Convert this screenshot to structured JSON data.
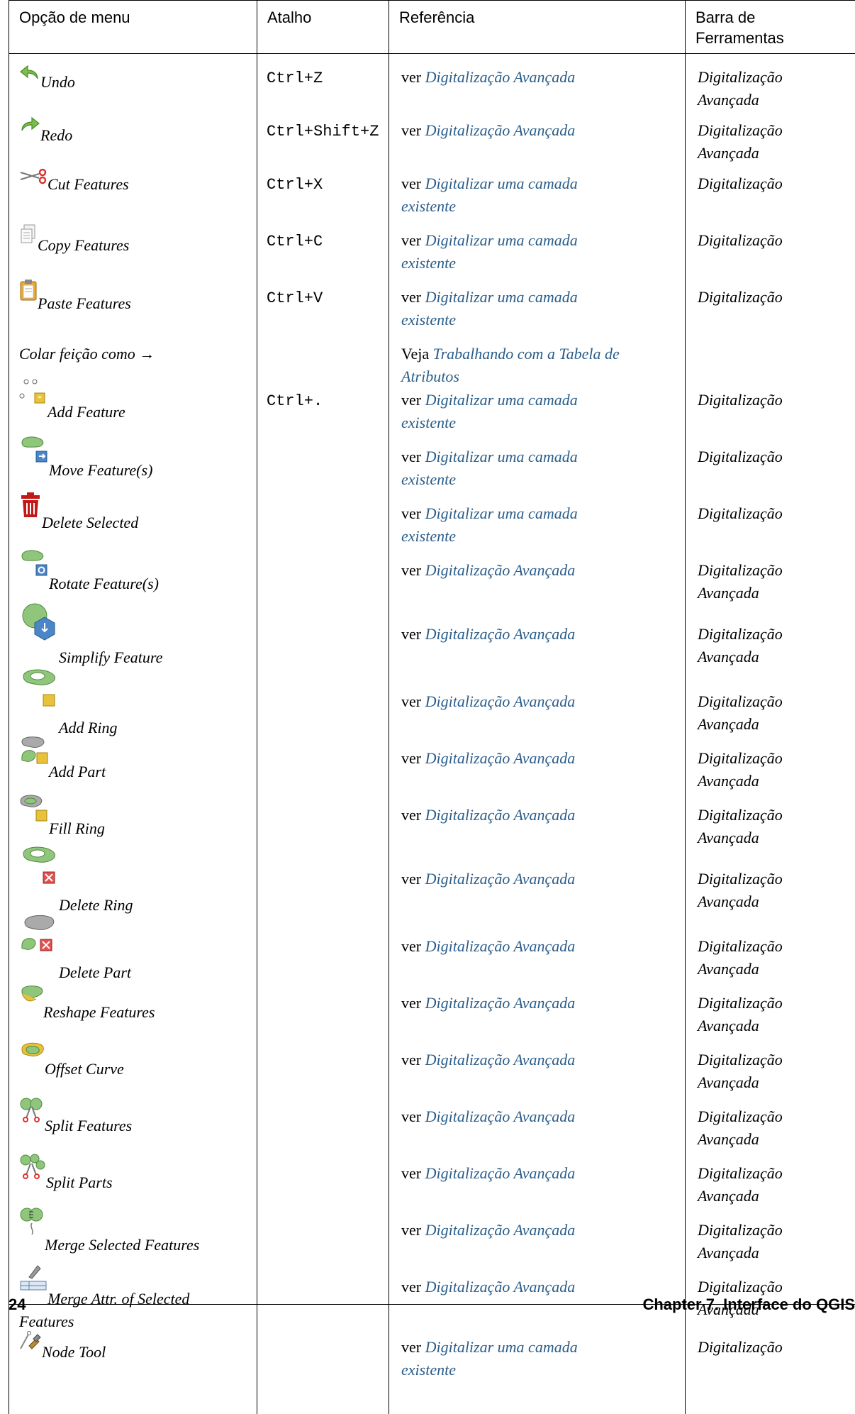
{
  "header": {
    "col1": "Opção de menu",
    "col2": "Atalho",
    "col3": "Referência",
    "col4_line1": "Barra de",
    "col4_line2": "Ferramentas"
  },
  "rows": [
    {
      "name": "Undo",
      "icon": "undo-icon",
      "shortcut": "Ctrl+Z",
      "ref_prefix": "ver",
      "ref_l1": "Digitalização Avançada",
      "ref_l2": "",
      "tb1": "Digitalização",
      "tb2": "Avançada"
    },
    {
      "name": "Redo",
      "icon": "redo-icon",
      "shortcut": "Ctrl+Shift+Z",
      "ref_prefix": "ver",
      "ref_l1": "Digitalização Avançada",
      "ref_l2": "",
      "tb1": "Digitalização",
      "tb2": "Avançada"
    },
    {
      "name": "Cut Features",
      "icon": "scissors-icon",
      "shortcut": "Ctrl+X",
      "ref_prefix": "ver",
      "ref_l1": "Digitalizar uma camada",
      "ref_l2": "existente",
      "tb1": "Digitalização",
      "tb2": ""
    },
    {
      "name": "Copy Features",
      "icon": "copy-icon",
      "shortcut": "Ctrl+C",
      "ref_prefix": "ver",
      "ref_l1": "Digitalizar uma camada",
      "ref_l2": "existente",
      "tb1": "Digitalização",
      "tb2": ""
    },
    {
      "name": "Paste Features",
      "icon": "clipboard-icon",
      "shortcut": "Ctrl+V",
      "ref_prefix": "ver",
      "ref_l1": "Digitalizar uma camada",
      "ref_l2": "existente",
      "tb1": "Digitalização",
      "tb2": ""
    },
    {
      "name": "Colar feição como →",
      "icon": "",
      "shortcut": "",
      "ref_prefix": "Veja",
      "ref_l1": "Trabalhando com a Tabela de",
      "ref_l2": "Atributos",
      "tb1": "",
      "tb2": ""
    },
    {
      "name": "Add Feature",
      "icon": "add-feature-icon",
      "shortcut": "Ctrl+.",
      "ref_prefix": "ver",
      "ref_l1": "Digitalizar uma camada",
      "ref_l2": "existente",
      "tb1": "Digitalização",
      "tb2": ""
    },
    {
      "name": "Move Feature(s)",
      "icon": "move-feature-icon",
      "shortcut": "",
      "ref_prefix": "ver",
      "ref_l1": "Digitalizar uma camada",
      "ref_l2": "existente",
      "tb1": "Digitalização",
      "tb2": ""
    },
    {
      "name": "Delete Selected",
      "icon": "trash-icon",
      "shortcut": "",
      "ref_prefix": "ver",
      "ref_l1": "Digitalizar uma camada",
      "ref_l2": "existente",
      "tb1": "Digitalização",
      "tb2": ""
    },
    {
      "name": "Rotate Feature(s)",
      "icon": "rotate-feature-icon",
      "shortcut": "",
      "ref_prefix": "ver",
      "ref_l1": "Digitalização Avançada",
      "ref_l2": "",
      "tb1": "Digitalização",
      "tb2": "Avançada"
    },
    {
      "name": "Simplify Feature",
      "icon": "simplify-feature-icon",
      "shortcut": "",
      "ref_prefix": "ver",
      "ref_l1": "Digitalização Avançada",
      "ref_l2": "",
      "tb1": "Digitalização",
      "tb2": "Avançada"
    },
    {
      "name": "Add Ring",
      "icon": "add-ring-icon",
      "shortcut": "",
      "ref_prefix": "ver",
      "ref_l1": "Digitalização Avançada",
      "ref_l2": "",
      "tb1": "Digitalização",
      "tb2": "Avançada"
    },
    {
      "name": "Add Part",
      "icon": "add-part-icon",
      "shortcut": "",
      "ref_prefix": "ver",
      "ref_l1": "Digitalização Avançada",
      "ref_l2": "",
      "tb1": "Digitalização",
      "tb2": "Avançada"
    },
    {
      "name": "Fill Ring",
      "icon": "fill-ring-icon",
      "shortcut": "",
      "ref_prefix": "ver",
      "ref_l1": "Digitalização Avançada",
      "ref_l2": "",
      "tb1": "Digitalização",
      "tb2": "Avançada"
    },
    {
      "name": "Delete Ring",
      "icon": "delete-ring-icon",
      "shortcut": "",
      "ref_prefix": "ver",
      "ref_l1": "Digitalização Avançada",
      "ref_l2": "",
      "tb1": "Digitalização",
      "tb2": "Avançada"
    },
    {
      "name": "Delete Part",
      "icon": "delete-part-icon",
      "shortcut": "",
      "ref_prefix": "ver",
      "ref_l1": "Digitalização Avançada",
      "ref_l2": "",
      "tb1": "Digitalização",
      "tb2": "Avançada"
    },
    {
      "name": "Reshape Features",
      "icon": "reshape-features-icon",
      "shortcut": "",
      "ref_prefix": "ver",
      "ref_l1": "Digitalização Avançada",
      "ref_l2": "",
      "tb1": "Digitalização",
      "tb2": "Avançada"
    },
    {
      "name": "Offset Curve",
      "icon": "offset-curve-icon",
      "shortcut": "",
      "ref_prefix": "ver",
      "ref_l1": "Digitalização Avançada",
      "ref_l2": "",
      "tb1": "Digitalização",
      "tb2": "Avançada"
    },
    {
      "name": "Split Features",
      "icon": "split-features-icon",
      "shortcut": "",
      "ref_prefix": "ver",
      "ref_l1": "Digitalização Avançada",
      "ref_l2": "",
      "tb1": "Digitalização",
      "tb2": "Avançada"
    },
    {
      "name": "Split Parts",
      "icon": "split-parts-icon",
      "shortcut": "",
      "ref_prefix": "ver",
      "ref_l1": "Digitalização Avançada",
      "ref_l2": "",
      "tb1": "Digitalização",
      "tb2": "Avançada"
    },
    {
      "name": "Merge Selected Features",
      "icon": "merge-features-icon",
      "shortcut": "",
      "ref_prefix": "ver",
      "ref_l1": "Digitalização Avançada",
      "ref_l2": "",
      "tb1": "Digitalização",
      "tb2": "Avançada"
    },
    {
      "name": "Merge Attr. of Selected",
      "name2": "Features",
      "icon": "merge-attributes-icon",
      "shortcut": "",
      "ref_prefix": "ver",
      "ref_l1": "Digitalização Avançada",
      "ref_l2": "",
      "tb1": "Digitalização",
      "tb2": "Avançada"
    },
    {
      "name": "Node Tool",
      "icon": "node-tool-icon",
      "shortcut": "",
      "ref_prefix": "ver",
      "ref_l1": "Digitalizar uma camada",
      "ref_l2": "existente",
      "tb1": "Digitalização",
      "tb2": ""
    }
  ],
  "footer": {
    "page_number": "24",
    "chapter": "Chapter 7.  Interface do QGIS"
  }
}
